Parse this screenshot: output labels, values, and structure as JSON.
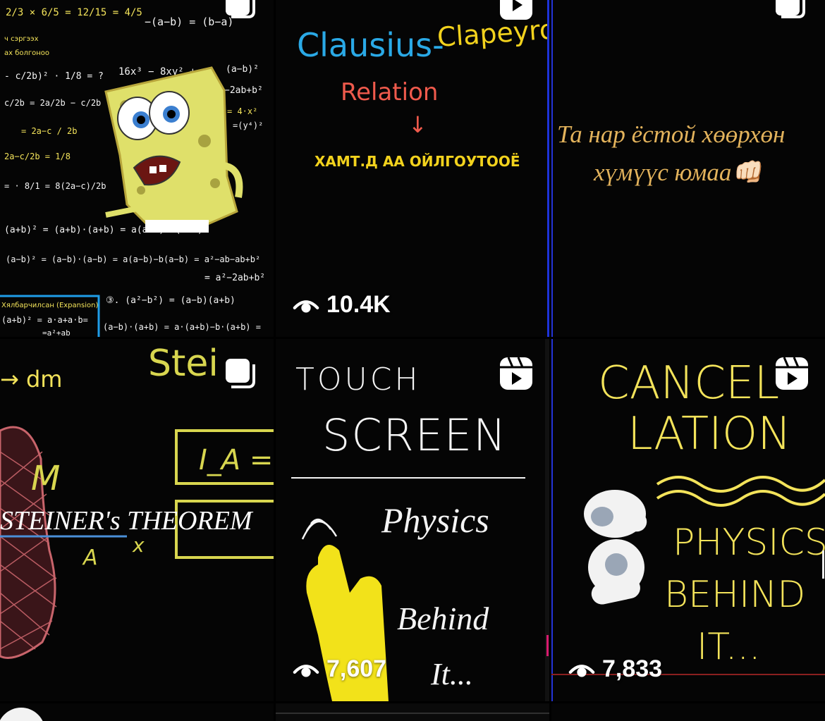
{
  "tiles": [
    {
      "id": "tile-1",
      "type": "carousel",
      "badge_icon": "carousel-icon",
      "text": {
        "formula_top": "−(a−b) = (b−a)",
        "formula_2": "16x³ − 8xy² + y³",
        "formula_3": "(a+b)² = (a+b)·(a+b) = a(a+b)+b(a+b)",
        "formula_4": "(a−b)² = (a−b)·(a−b) = a(a−b)−b(a−b) = a²−ab−ab+b²",
        "formula_5": "= a²−2ab+b²",
        "formula_6": "③. (a²−b²) = (a−b)(a+b)",
        "formula_7": "(a−b)·(a+b) = a·(a+b)−b·(a+b) =",
        "box_label": "Хялбарчилсан (Expansion)"
      }
    },
    {
      "id": "tile-2",
      "type": "reel",
      "badge_icon": "reel-icon",
      "text": {
        "title_a": "Clausius-",
        "title_b": "Clapeyron",
        "subtitle": "Relation",
        "arrow": "↓",
        "caption": "ХАМТ.Д АА ОЙЛГОУТООЁ"
      },
      "views": "10.4K"
    },
    {
      "id": "tile-3",
      "type": "carousel",
      "badge_icon": "carousel-icon",
      "text": {
        "line1": "Та нар ёстой хөөрхөн",
        "line2": "хүмүүс юмаа👊🏻"
      }
    },
    {
      "id": "tile-4",
      "type": "carousel",
      "badge_icon": "carousel-icon",
      "text": {
        "dm": "→ dm",
        "title_partial": "Stei",
        "m": "M",
        "theorem": "STEINER's THEOREM",
        "a": "A",
        "x": "x",
        "ia": "I_A ="
      }
    },
    {
      "id": "tile-5",
      "type": "reel",
      "badge_icon": "reel-icon",
      "text": {
        "touch": "TOUCH",
        "screen": "SCREEN",
        "physics": "Physics",
        "behind": "Behind",
        "it": "It..."
      },
      "views": "7,607"
    },
    {
      "id": "tile-6",
      "type": "reel",
      "badge_icon": "reel-icon",
      "text": {
        "cancel": "CANCEL-",
        "lation": "LATION",
        "physics": "PHYSICS",
        "behind": "BEHIND",
        "it": "IT..."
      },
      "views": "7,833"
    }
  ],
  "colors": {
    "chalk_yellow": "#f3e35a",
    "chalk_white": "#f4f4f4",
    "clausius_blue": "#2aa9e6",
    "clapeyron_yellow": "#f2d21d",
    "relation_red": "#ef5a4c",
    "tile3_text": "#e3b35c"
  }
}
